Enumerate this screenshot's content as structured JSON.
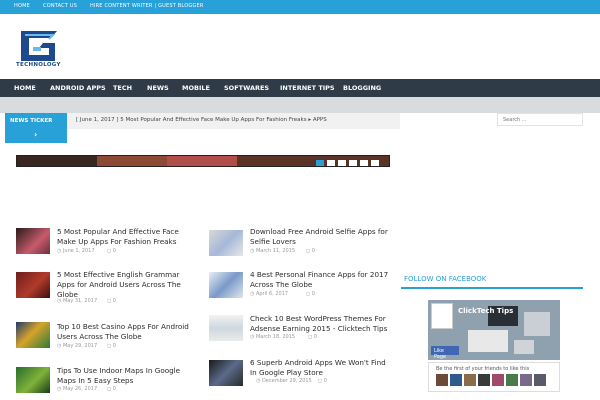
{
  "topbar": {
    "links": [
      "HOME",
      "CONTACT US",
      "HIRE CONTENT WRITER | GUEST BLOGGER"
    ]
  },
  "logo": {
    "text": "TECHNOLOGY"
  },
  "nav": {
    "items": [
      "HOME",
      "ANDROID APPS",
      "TECH",
      "NEWS",
      "MOBILE",
      "SOFTWARES",
      "INTERNET TIPS",
      "BLOGGING"
    ]
  },
  "ticker": {
    "title": "NEWS TICKER",
    "arrow": "›",
    "text": "[ June 1, 2017 ]  5 Most Popular And Effective Face Make Up Apps For Fashion Freaks  ▸ APPS"
  },
  "search": {
    "placeholder": "Search ..."
  },
  "posts_left": [
    {
      "title": "5 Most Popular And Effective Face Make Up Apps For Fashion Freaks",
      "date": "June 1, 2017",
      "comments": "0"
    },
    {
      "title": "5 Most Effective English Grammar Apps for Android Users Across The Globe",
      "date": "May 31, 2017",
      "comments": "0"
    },
    {
      "title": "Top 10 Best Casino Apps For Android Users Across The Globe",
      "date": "May 29, 2017",
      "comments": "0"
    },
    {
      "title": "Tips To Use Indoor Maps In Google Maps In 5 Easy Steps",
      "date": "May 26, 2017",
      "comments": "0"
    }
  ],
  "posts_right": [
    {
      "title": "Download Free Android Selfie Apps for Selfie Lovers",
      "date": "March 11, 2015",
      "comments": "0"
    },
    {
      "title": "4 Best Personal Finance Apps for 2017 Across The Globe",
      "date": "April 6, 2017",
      "comments": "0"
    },
    {
      "title": "Check 10 Best WordPress Themes For Adsense Earning 2015 - Clicktech Tips",
      "date": "March 18, 2015",
      "comments": "0"
    },
    {
      "title": "6 Superb Android Apps We Won't Find In Google Play Store",
      "date": "December 29, 2015",
      "comments": "0"
    }
  ],
  "follow": {
    "title": "FOLLOW ON FACEBOOK",
    "page_name": "ClickTech Tips",
    "like": "Like Page",
    "friends": "Be the first of your friends to like this"
  },
  "colors": {
    "accent": "#28a0d8",
    "nav_bg": "#2f3b46"
  }
}
